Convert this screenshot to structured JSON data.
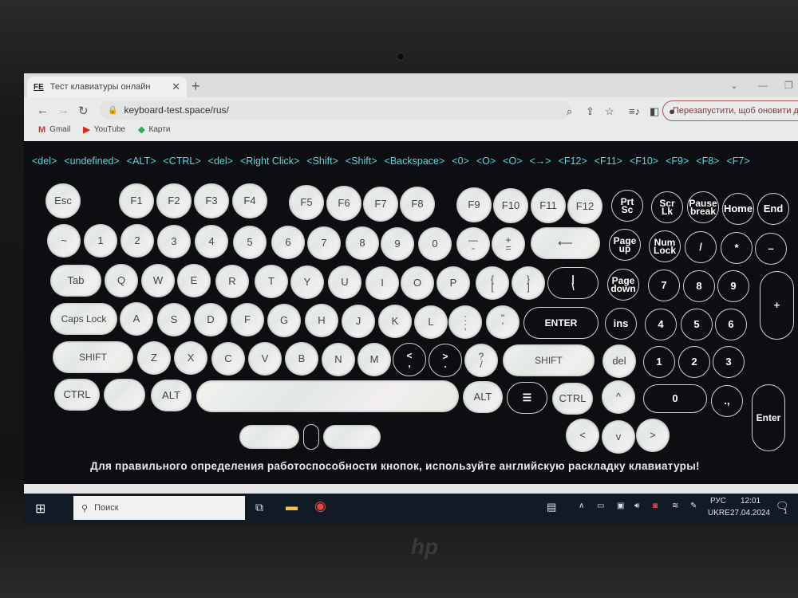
{
  "browser": {
    "tab_favicon": "FE",
    "tab_title": "Тест клавиатуры онлайн",
    "tab_close": "✕",
    "new_tab": "+",
    "url": "keyboard-test.space/rus/",
    "restart_label": "Перезапустити, щоб оновити да",
    "bookmarks": [
      {
        "label": "Gmail",
        "icon": "gmail-icon",
        "glyph": "M",
        "color": "#d93025"
      },
      {
        "label": "YouTube",
        "icon": "youtube-icon",
        "glyph": "▶",
        "color": "#e62117"
      },
      {
        "label": "Карти",
        "icon": "maps-icon",
        "glyph": "◆",
        "color": "#34a853"
      }
    ]
  },
  "event_log": [
    "<del>",
    "<undefined>",
    "<ALT>",
    "<CTRL>",
    "<del>",
    "<Right Click>",
    "<Shift>",
    "<Shift>",
    "<Backspace>",
    "<0>",
    "<O>",
    "<O>",
    "<→>",
    "<F12>",
    "<F11>",
    "<F10>",
    "<F9>",
    "<F8>",
    "<F7>"
  ],
  "keys": [
    {
      "label": "Esc",
      "pressed": true
    },
    {
      "label": "F1",
      "pressed": true
    },
    {
      "label": "F2",
      "pressed": true
    },
    {
      "label": "F3",
      "pressed": true
    },
    {
      "label": "F4",
      "pressed": true
    },
    {
      "label": "F5",
      "pressed": true
    },
    {
      "label": "F6",
      "pressed": true
    },
    {
      "label": "F7",
      "pressed": true
    },
    {
      "label": "F8",
      "pressed": true
    },
    {
      "label": "F9",
      "pressed": true
    },
    {
      "label": "F10",
      "pressed": true
    },
    {
      "label": "F11",
      "pressed": true
    },
    {
      "label": "F12",
      "pressed": true
    },
    {
      "label": "Prt\nSc",
      "pressed": false
    },
    {
      "label": "Scr\nLk",
      "pressed": false
    },
    {
      "label": "Pause\nbreak",
      "pressed": false
    },
    {
      "label": "Home",
      "pressed": false
    },
    {
      "label": "End",
      "pressed": false
    },
    {
      "label": "~",
      "pressed": true
    },
    {
      "label": "1",
      "pressed": true
    },
    {
      "label": "2",
      "pressed": true
    },
    {
      "label": "3",
      "pressed": true
    },
    {
      "label": "4",
      "pressed": true
    },
    {
      "label": "5",
      "pressed": true
    },
    {
      "label": "6",
      "pressed": true
    },
    {
      "label": "7",
      "pressed": true
    },
    {
      "label": "8",
      "pressed": true
    },
    {
      "label": "9",
      "pressed": true
    },
    {
      "label": "0",
      "pressed": true
    },
    {
      "label": "—\n-",
      "pressed": true
    },
    {
      "label": "+\n=",
      "pressed": true
    },
    {
      "label": "⟵",
      "pressed": true
    },
    {
      "label": "Page\nup",
      "pressed": false
    },
    {
      "label": "Num\nLock",
      "pressed": false
    },
    {
      "label": "/",
      "pressed": false
    },
    {
      "label": "*",
      "pressed": false
    },
    {
      "label": "–",
      "pressed": false
    },
    {
      "label": "Tab",
      "pressed": true
    },
    {
      "label": "Q",
      "pressed": true
    },
    {
      "label": "W",
      "pressed": true
    },
    {
      "label": "E",
      "pressed": true
    },
    {
      "label": "R",
      "pressed": true
    },
    {
      "label": "T",
      "pressed": true
    },
    {
      "label": "Y",
      "pressed": true
    },
    {
      "label": "U",
      "pressed": true
    },
    {
      "label": "I",
      "pressed": true
    },
    {
      "label": "O",
      "pressed": true
    },
    {
      "label": "P",
      "pressed": true
    },
    {
      "label": "{\n[",
      "pressed": true
    },
    {
      "label": "}\n]",
      "pressed": true
    },
    {
      "label": "|\n\\",
      "pressed": false
    },
    {
      "label": "Page\ndown",
      "pressed": false
    },
    {
      "label": "7",
      "pressed": false
    },
    {
      "label": "8",
      "pressed": false
    },
    {
      "label": "9",
      "pressed": false
    },
    {
      "label": "+",
      "pressed": false
    },
    {
      "label": "Caps Lock",
      "pressed": true
    },
    {
      "label": "A",
      "pressed": true
    },
    {
      "label": "S",
      "pressed": true
    },
    {
      "label": "D",
      "pressed": true
    },
    {
      "label": "F",
      "pressed": true
    },
    {
      "label": "G",
      "pressed": true
    },
    {
      "label": "H",
      "pressed": true
    },
    {
      "label": "J",
      "pressed": true
    },
    {
      "label": "K",
      "pressed": true
    },
    {
      "label": "L",
      "pressed": true
    },
    {
      "label": ":\n;",
      "pressed": true
    },
    {
      "label": "\"\n'",
      "pressed": true
    },
    {
      "label": "ENTER",
      "pressed": false
    },
    {
      "label": "ins",
      "pressed": false
    },
    {
      "label": "4",
      "pressed": false
    },
    {
      "label": "5",
      "pressed": false
    },
    {
      "label": "6",
      "pressed": false
    },
    {
      "label": "SHIFT",
      "pressed": true
    },
    {
      "label": "Z",
      "pressed": true
    },
    {
      "label": "X",
      "pressed": true
    },
    {
      "label": "C",
      "pressed": true
    },
    {
      "label": "V",
      "pressed": true
    },
    {
      "label": "B",
      "pressed": true
    },
    {
      "label": "N",
      "pressed": true
    },
    {
      "label": "M",
      "pressed": true
    },
    {
      "label": "<\n,",
      "pressed": false
    },
    {
      "label": ">\n.",
      "pressed": false
    },
    {
      "label": "?\n/",
      "pressed": true
    },
    {
      "label": "SHIFT",
      "pressed": true
    },
    {
      "label": "del",
      "pressed": true
    },
    {
      "label": "1",
      "pressed": false
    },
    {
      "label": "2",
      "pressed": false
    },
    {
      "label": "3",
      "pressed": false
    },
    {
      "label": "CTRL",
      "pressed": true
    },
    {
      "label": "",
      "pressed": true
    },
    {
      "label": "ALT",
      "pressed": true
    },
    {
      "label": "",
      "pressed": true
    },
    {
      "label": "ALT",
      "pressed": true
    },
    {
      "label": "☰",
      "pressed": false
    },
    {
      "label": "CTRL",
      "pressed": true
    },
    {
      "label": "^",
      "pressed": true
    },
    {
      "label": "0",
      "pressed": false
    },
    {
      "label": ".,",
      "pressed": false
    },
    {
      "label": "Enter",
      "pressed": false
    },
    {
      "label": "",
      "pressed": true
    },
    {
      "label": "",
      "pressed": false
    },
    {
      "label": "",
      "pressed": true
    },
    {
      "label": "<",
      "pressed": true
    },
    {
      "label": "v",
      "pressed": true
    },
    {
      "label": ">",
      "pressed": true
    }
  ],
  "hint": "Для правильного определения работоспособности кнопок, используйте английскую раскладку клавиатуры!",
  "taskbar": {
    "search_placeholder": "Поиск",
    "language_top": "РУС",
    "language_bottom": "UKRE",
    "time": "12:01",
    "date": "27.04.2024",
    "notification_count": "1"
  },
  "colors": {
    "log_text": "#5fd3e0",
    "pressed_key": "#e8ebe6",
    "restart_border": "#a45a5e"
  }
}
